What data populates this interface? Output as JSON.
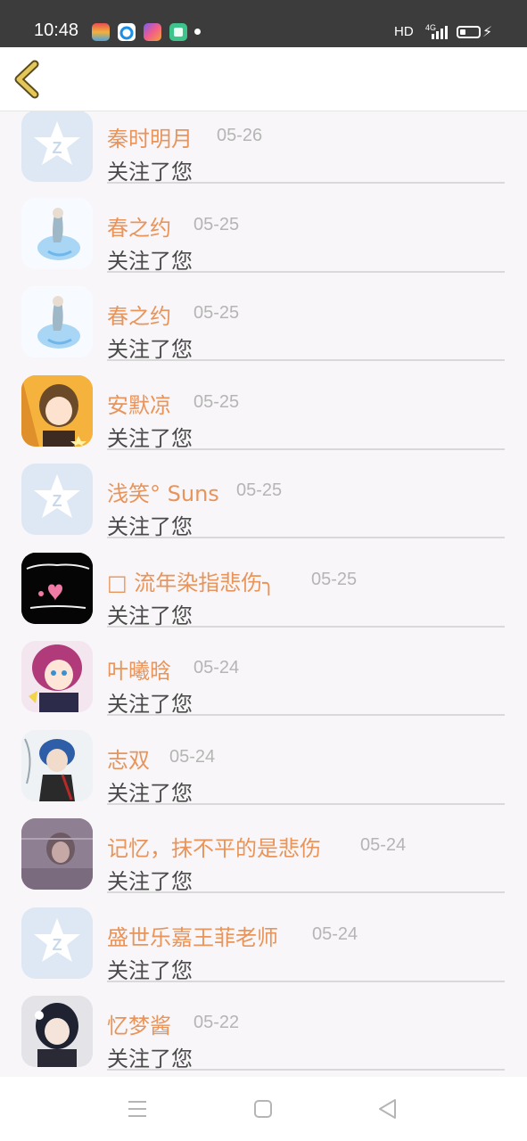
{
  "status_bar": {
    "time": "10:48",
    "hd_label": "HD",
    "network_label": "4G",
    "notification_icons": [
      "colorful-app-icon",
      "blue-cloud-icon",
      "gradient-diamond-icon",
      "green-square-icon"
    ]
  },
  "header": {
    "back_icon": "chevron-left-icon",
    "accent_color": "#e3c75a"
  },
  "colors": {
    "name": "#e8945a",
    "date": "#b5b5b5",
    "message": "#4a4a4a"
  },
  "followers": [
    {
      "name": "秦时明月",
      "date": "05-26",
      "message": "关注了您",
      "avatar": "qq-default-avatar"
    },
    {
      "name": "春之约",
      "date": "05-25",
      "message": "关注了您",
      "avatar": "mermaid-avatar"
    },
    {
      "name": "春之约",
      "date": "05-25",
      "message": "关注了您",
      "avatar": "mermaid-avatar"
    },
    {
      "name": "安默凉",
      "date": "05-25",
      "message": "关注了您",
      "avatar": "anime-girl-avatar"
    },
    {
      "name": "浅笑° Suns",
      "date": "05-25",
      "message": "关注了您",
      "avatar": "qq-default-avatar"
    },
    {
      "name": "□ 流年染指悲伤╮",
      "date": "05-25",
      "message": "关注了您",
      "avatar": "black-hearts-avatar"
    },
    {
      "name": "叶曦晗",
      "date": "05-24",
      "message": "关注了您",
      "avatar": "anime-pink-hair-avatar"
    },
    {
      "name": "志双",
      "date": "05-24",
      "message": "关注了您",
      "avatar": "anime-boy-avatar"
    },
    {
      "name": "记忆，抹不平的是悲伤",
      "date": "05-24",
      "message": "关注了您",
      "avatar": "purple-photo-avatar"
    },
    {
      "name": "盛世乐嘉王菲老师",
      "date": "05-24",
      "message": "关注了您",
      "avatar": "qq-default-avatar"
    },
    {
      "name": "忆梦酱",
      "date": "05-22",
      "message": "关注了您",
      "avatar": "anime-dark-hair-avatar"
    }
  ],
  "nav_bar": {
    "icons": [
      "menu-icon",
      "home-square-icon",
      "back-triangle-icon"
    ]
  }
}
